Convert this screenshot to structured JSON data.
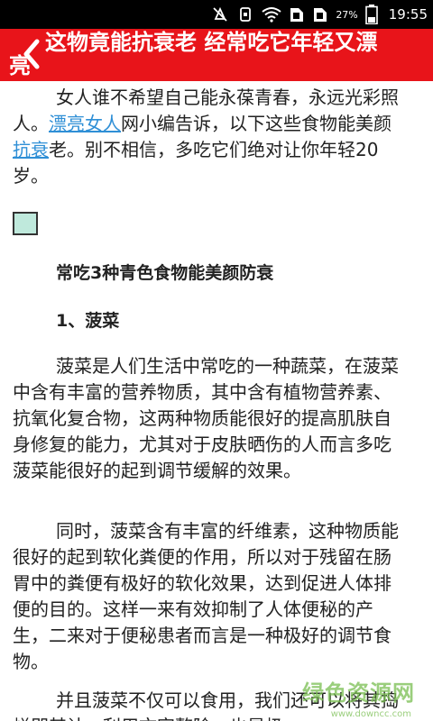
{
  "status_bar": {
    "battery_percent": "27%",
    "time": "19:55",
    "icons": [
      "mute-icon",
      "phone-vibrate-icon",
      "wifi-icon",
      "sim1-icon",
      "sim2-icon",
      "battery-icon"
    ]
  },
  "header": {
    "title_line1": "这物竟能抗衰老 经常吃它年轻又漂",
    "title_line2": "亮",
    "back_icon": "chevron-left-icon",
    "background_color": "#e8141a"
  },
  "article": {
    "intro": {
      "part1": "女人谁不希望自己能永葆青春，永远光彩照人。",
      "link1": "漂亮女人",
      "part2": "网小编告诉，以下这些食物能美颜",
      "link2": "抗衰",
      "part3": "老。别不相信，多吃它们绝对让你年轻20岁。"
    },
    "section_heading": "常吃3种青色食物能美颜防衰",
    "item_heading": "1、菠菜",
    "paragraphs": [
      "菠菜是人们生活中常吃的一种蔬菜，在菠菜中含有丰富的营养物质，其中含有植物营养素、抗氧化复合物，这两种物质能很好的提高肌肤自身修复的能力，尤其对于皮肤晒伤的人而言多吃菠菜能很好的起到调节缓解的效果。",
      "同时，菠菜含有丰富的纤维素，这种物质能很好的起到软化粪便的作用，所以对于残留在肠胃中的粪便有极好的软化效果，达到促进人体排便的目的。这样一来有效抑制了人体便秘的产生，二来对于便秘患者而言是一种极好的调节食物。",
      "并且菠菜不仅可以食用，我们还可以将其捣烂即其计，利用文字整除，也是极"
    ]
  },
  "watermark": {
    "text": "绿色资源网",
    "url": "www.downcc.com"
  }
}
